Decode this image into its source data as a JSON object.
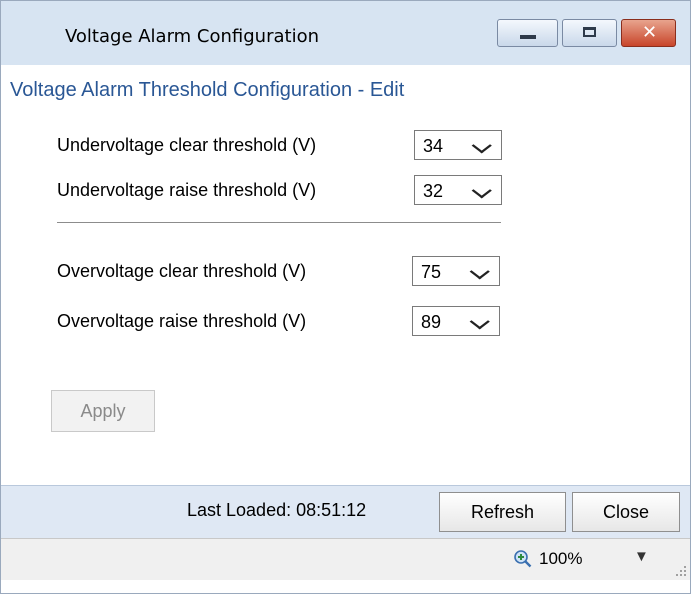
{
  "window": {
    "title": "Voltage Alarm Configuration",
    "controls": {
      "minimize": "minimize",
      "maximize": "maximize",
      "close": "✕"
    }
  },
  "heading": "Voltage Alarm Threshold Configuration - Edit",
  "fields": [
    {
      "label": "Undervoltage clear threshold (V)",
      "value": "34"
    },
    {
      "label": "Undervoltage raise threshold (V)",
      "value": "32"
    },
    {
      "label": "Overvoltage clear threshold (V)",
      "value": "75"
    },
    {
      "label": "Overvoltage raise threshold (V)",
      "value": "89"
    }
  ],
  "apply_label": "Apply",
  "footer": {
    "last_loaded": "Last Loaded: 08:51:12",
    "refresh_label": "Refresh",
    "close_label": "Close"
  },
  "statusbar": {
    "zoom": "100%"
  },
  "colors": {
    "heading": "#2a5795",
    "titlebar": "#d7e4f2",
    "footer": "#dfe8f4",
    "close_button": "#c8452a"
  }
}
